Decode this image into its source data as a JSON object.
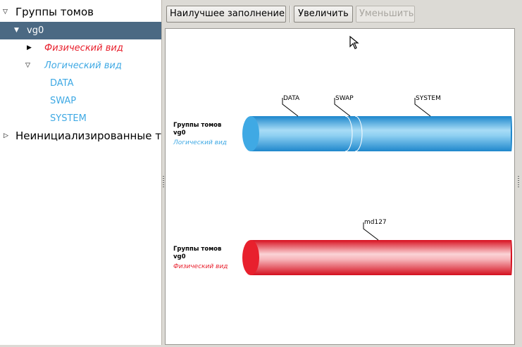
{
  "tree": {
    "volume_groups_label": "Группы томов",
    "vg_label": "vg0",
    "physical_view_label": "Физический вид",
    "logical_view_label": "Логический вид",
    "lv_items": [
      "DATA",
      "SWAP",
      "SYSTEM"
    ],
    "uninitialized_label": "Неинициализированные т"
  },
  "toolbar": {
    "best_fit_label": "Наилучшее заполнение",
    "zoom_in_label": "Увеличить",
    "zoom_out_label": "Уменьшить"
  },
  "logical": {
    "group_label": "Группы томов",
    "vg_label": "vg0",
    "view_label": "Логический вид",
    "segments": [
      {
        "label": "DATA",
        "fraction": 0.38
      },
      {
        "label": "SWAP",
        "fraction": 0.04
      },
      {
        "label": "SYSTEM",
        "fraction": 0.58
      }
    ]
  },
  "physical": {
    "group_label": "Группы томов",
    "vg_label": "vg0",
    "view_label": "Физический вид",
    "pv_label": "md127"
  },
  "colors": {
    "selection": "#4b6983",
    "logical": "#3fa0dc",
    "physical": "#e8202d",
    "physical_text": "#e8202d",
    "logical_text": "#3fa9e4"
  }
}
